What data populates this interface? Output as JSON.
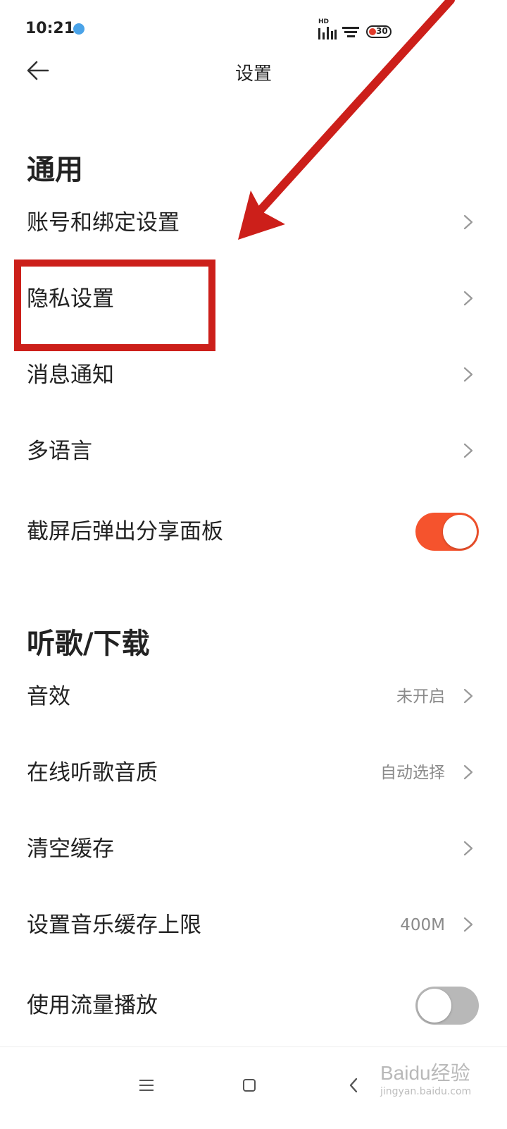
{
  "status_bar": {
    "time": "10:21",
    "network_label": "HD",
    "battery_level": "30"
  },
  "header": {
    "title": "设置"
  },
  "sections": [
    {
      "title": "通用",
      "rows": [
        {
          "label": "账号和绑定设置",
          "value": "",
          "control": "chevron"
        },
        {
          "label": "隐私设置",
          "value": "",
          "control": "chevron"
        },
        {
          "label": "消息通知",
          "value": "",
          "control": "chevron"
        },
        {
          "label": "多语言",
          "value": "",
          "control": "chevron"
        },
        {
          "label": "截屏后弹出分享面板",
          "value": "",
          "control": "toggle",
          "on": true
        }
      ]
    },
    {
      "title": "听歌/下载",
      "rows": [
        {
          "label": "音效",
          "value": "未开启",
          "control": "chevron"
        },
        {
          "label": "在线听歌音质",
          "value": "自动选择",
          "control": "chevron"
        },
        {
          "label": "清空缓存",
          "value": "",
          "control": "chevron"
        },
        {
          "label": "设置音乐缓存上限",
          "value": "400M",
          "control": "chevron"
        },
        {
          "label": "使用流量播放",
          "value": "",
          "control": "toggle",
          "on": false
        }
      ]
    }
  ],
  "watermark": {
    "brand": "Baidu经验",
    "url": "jingyan.baidu.com"
  },
  "colors": {
    "toggle_on": "#f5532d",
    "annotation_red": "#cc1f1a"
  },
  "icons": [
    "back-arrow-icon",
    "chevron-right-icon",
    "menu-icon",
    "home-icon",
    "back-icon"
  ]
}
